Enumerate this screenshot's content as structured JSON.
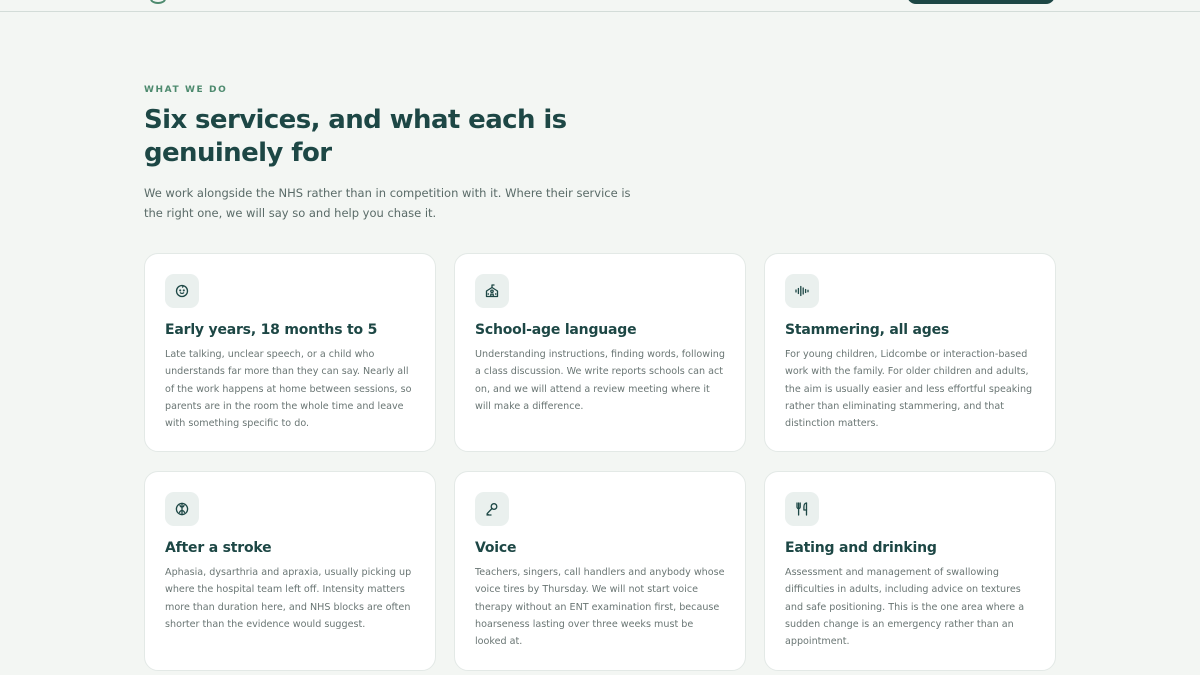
{
  "section": {
    "eyebrow": "WHAT WE DO",
    "title": "Six services, and what each is genuinely for",
    "lead": "We work alongside the NHS rather than in competition with it. Where their service is the right one, we will say so and help you chase it."
  },
  "services": [
    {
      "icon": "baby-face-icon",
      "title": "Early years, 18 months to 5",
      "description": "Late talking, unclear speech, or a child who understands far more than they can say. Nearly all of the work happens at home between sessions, so parents are in the room the whole time and leave with something specific to do."
    },
    {
      "icon": "school-icon",
      "title": "School-age language",
      "description": "Understanding instructions, finding words, following a class discussion. We write reports schools can act on, and we will attend a review meeting where it will make a difference."
    },
    {
      "icon": "audio-waveform-icon",
      "title": "Stammering, all ages",
      "description": "For young children, Lidcombe or interaction-based work with the family. For older children and adults, the aim is usually easier and less effortful speaking rather than eliminating stammering, and that distinction matters."
    },
    {
      "icon": "brain-icon",
      "title": "After a stroke",
      "description": "Aphasia, dysarthria and apraxia, usually picking up where the hospital team left off. Intensity matters more than duration here, and NHS blocks are often shorter than the evidence would suggest."
    },
    {
      "icon": "microphone-icon",
      "title": "Voice",
      "description": "Teachers, singers, call handlers and anybody whose voice tires by Thursday. We will not start voice therapy without an ENT examination first, because hoarseness lasting over three weeks must be looked at."
    },
    {
      "icon": "utensils-icon",
      "title": "Eating and drinking",
      "description": "Assessment and management of swallowing difficulties in adults, including advice on textures and safe positioning. This is the one area where a sudden change is an emergency rather than an appointment."
    }
  ],
  "colors": {
    "accent": "#1d4745",
    "eyebrow": "#4d8a6e",
    "background": "#f3f6f3",
    "card": "#ffffff"
  }
}
